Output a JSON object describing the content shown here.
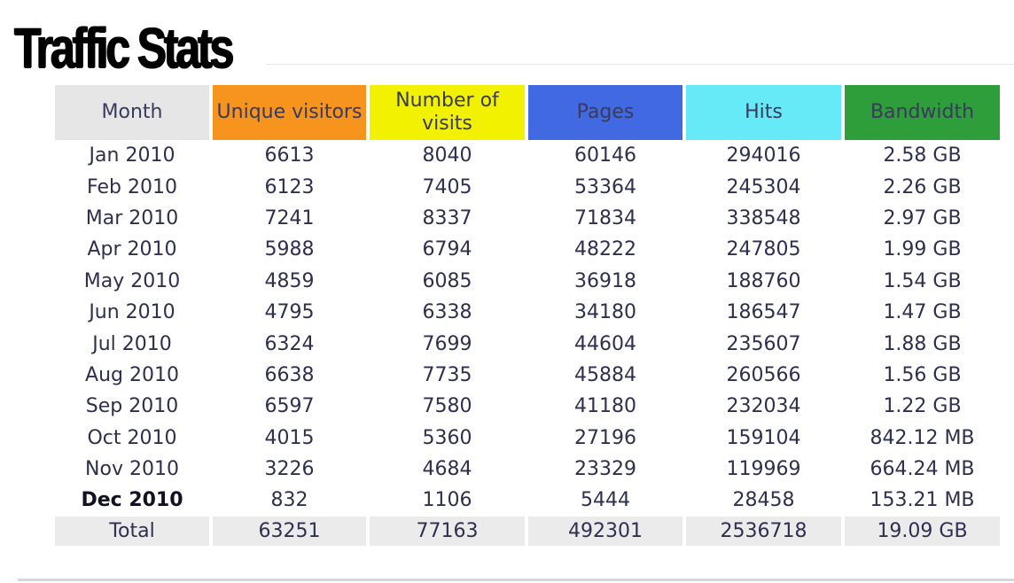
{
  "title": "Traffic Stats",
  "colors": {
    "month_header": "#e6e6e6",
    "visitors_header": "#f7941d",
    "visits_header": "#f2f200",
    "pages_header": "#4169e1",
    "hits_header": "#66eaf7",
    "bandwidth_header": "#2e9e3a",
    "total_row": "#ebebeb"
  },
  "table": {
    "headers": {
      "month": "Month",
      "visitors": "Unique visitors",
      "visits": "Number of visits",
      "pages": "Pages",
      "hits": "Hits",
      "bandwidth": "Bandwidth"
    },
    "rows": [
      {
        "month": "Jan 2010",
        "visitors": "6613",
        "visits": "8040",
        "pages": "60146",
        "hits": "294016",
        "bandwidth": "2.58 GB"
      },
      {
        "month": "Feb 2010",
        "visitors": "6123",
        "visits": "7405",
        "pages": "53364",
        "hits": "245304",
        "bandwidth": "2.26 GB"
      },
      {
        "month": "Mar 2010",
        "visitors": "7241",
        "visits": "8337",
        "pages": "71834",
        "hits": "338548",
        "bandwidth": "2.97 GB"
      },
      {
        "month": "Apr 2010",
        "visitors": "5988",
        "visits": "6794",
        "pages": "48222",
        "hits": "247805",
        "bandwidth": "1.99 GB"
      },
      {
        "month": "May 2010",
        "visitors": "4859",
        "visits": "6085",
        "pages": "36918",
        "hits": "188760",
        "bandwidth": "1.54 GB"
      },
      {
        "month": "Jun 2010",
        "visitors": "4795",
        "visits": "6338",
        "pages": "34180",
        "hits": "186547",
        "bandwidth": "1.47 GB"
      },
      {
        "month": "Jul 2010",
        "visitors": "6324",
        "visits": "7699",
        "pages": "44604",
        "hits": "235607",
        "bandwidth": "1.88 GB"
      },
      {
        "month": "Aug 2010",
        "visitors": "6638",
        "visits": "7735",
        "pages": "45884",
        "hits": "260566",
        "bandwidth": "1.56 GB"
      },
      {
        "month": "Sep 2010",
        "visitors": "6597",
        "visits": "7580",
        "pages": "41180",
        "hits": "232034",
        "bandwidth": "1.22 GB"
      },
      {
        "month": "Oct 2010",
        "visitors": "4015",
        "visits": "5360",
        "pages": "27196",
        "hits": "159104",
        "bandwidth": "842.12 MB"
      },
      {
        "month": "Nov 2010",
        "visitors": "3226",
        "visits": "4684",
        "pages": "23329",
        "hits": "119969",
        "bandwidth": "664.24 MB"
      },
      {
        "month": "Dec 2010",
        "visitors": "832",
        "visits": "1106",
        "pages": "5444",
        "hits": "28458",
        "bandwidth": "153.21 MB",
        "current": true
      }
    ],
    "total": {
      "month": "Total",
      "visitors": "63251",
      "visits": "77163",
      "pages": "492301",
      "hits": "2536718",
      "bandwidth": "19.09 GB"
    }
  }
}
